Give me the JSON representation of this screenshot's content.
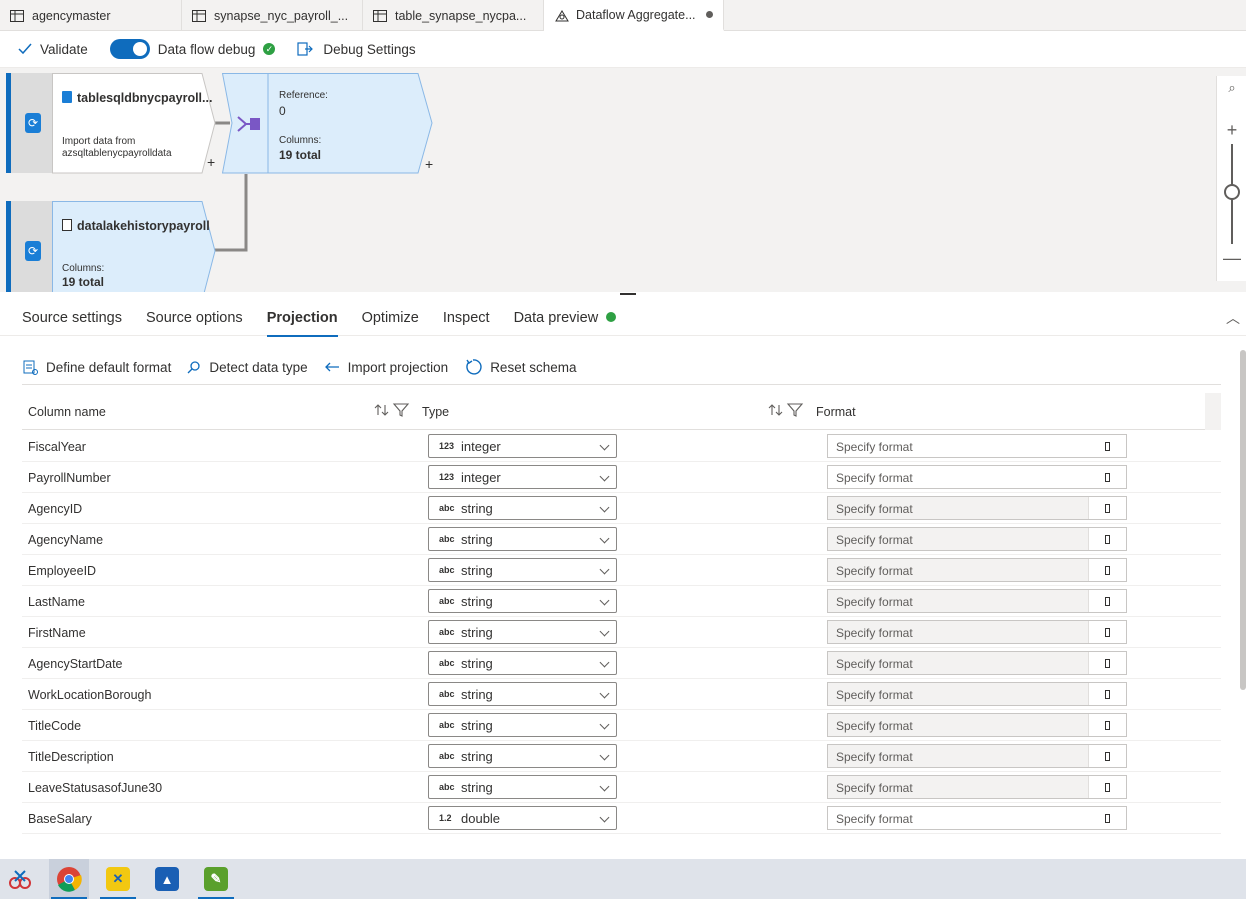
{
  "tabs": [
    {
      "label": "agencymaster",
      "icon": "table-icon"
    },
    {
      "label": "synapse_nyc_payroll_...",
      "icon": "table-icon"
    },
    {
      "label": "table_synapse_nycpa...",
      "icon": "table-icon"
    },
    {
      "label": "Dataflow Aggregate...",
      "icon": "dataflow-icon",
      "active": true,
      "unsaved": true
    }
  ],
  "toolbar": {
    "validate": "Validate",
    "debug": "Data flow debug",
    "debug_settings": "Debug Settings"
  },
  "canvas": {
    "source1": {
      "title": "tablesqldbnycpayroll...",
      "desc_line1": "Import data from",
      "desc_line2": "azsqltablenycpayrolldata"
    },
    "union": {
      "ref_label": "Reference:",
      "ref_value": "0",
      "cols_label": "Columns:",
      "cols_value": "19 total"
    },
    "source2": {
      "title": "datalakehistorypayroll",
      "cols_label": "Columns:",
      "cols_value": "19 total"
    },
    "plus": "+"
  },
  "panel_tabs": [
    "Source settings",
    "Source options",
    "Projection",
    "Optimize",
    "Inspect",
    "Data preview"
  ],
  "active_panel_tab": "Projection",
  "actions": {
    "define_default_format": "Define default format",
    "detect_data_type": "Detect data type",
    "import_projection": "Import projection",
    "reset_schema": "Reset schema"
  },
  "table": {
    "headers": {
      "column_name": "Column name",
      "type": "Type",
      "format": "Format"
    },
    "format_placeholder": "Specify format",
    "rows": [
      {
        "name": "FiscalYear",
        "type_icon": "123",
        "type": "integer",
        "format_enabled": true
      },
      {
        "name": "PayrollNumber",
        "type_icon": "123",
        "type": "integer",
        "format_enabled": true
      },
      {
        "name": "AgencyID",
        "type_icon": "abc",
        "type": "string",
        "format_enabled": false
      },
      {
        "name": "AgencyName",
        "type_icon": "abc",
        "type": "string",
        "format_enabled": false
      },
      {
        "name": "EmployeeID",
        "type_icon": "abc",
        "type": "string",
        "format_enabled": false
      },
      {
        "name": "LastName",
        "type_icon": "abc",
        "type": "string",
        "format_enabled": false
      },
      {
        "name": "FirstName",
        "type_icon": "abc",
        "type": "string",
        "format_enabled": false
      },
      {
        "name": "AgencyStartDate",
        "type_icon": "abc",
        "type": "string",
        "format_enabled": false
      },
      {
        "name": "WorkLocationBorough",
        "type_icon": "abc",
        "type": "string",
        "format_enabled": false
      },
      {
        "name": "TitleCode",
        "type_icon": "abc",
        "type": "string",
        "format_enabled": false
      },
      {
        "name": "TitleDescription",
        "type_icon": "abc",
        "type": "string",
        "format_enabled": false
      },
      {
        "name": "LeaveStatusasofJune30",
        "type_icon": "abc",
        "type": "string",
        "format_enabled": false
      },
      {
        "name": "BaseSalary",
        "type_icon": "1.2",
        "type": "double",
        "format_enabled": true
      }
    ]
  },
  "taskbar": [
    {
      "name": "snipping-tool-icon",
      "color": "#e8f0ff"
    },
    {
      "name": "chrome-icon",
      "color": "#db4437"
    },
    {
      "name": "tool-app-icon",
      "color": "#f2c811"
    },
    {
      "name": "photos-icon",
      "color": "#1a5fb4"
    },
    {
      "name": "notepad-icon",
      "color": "#5aa02c"
    }
  ]
}
